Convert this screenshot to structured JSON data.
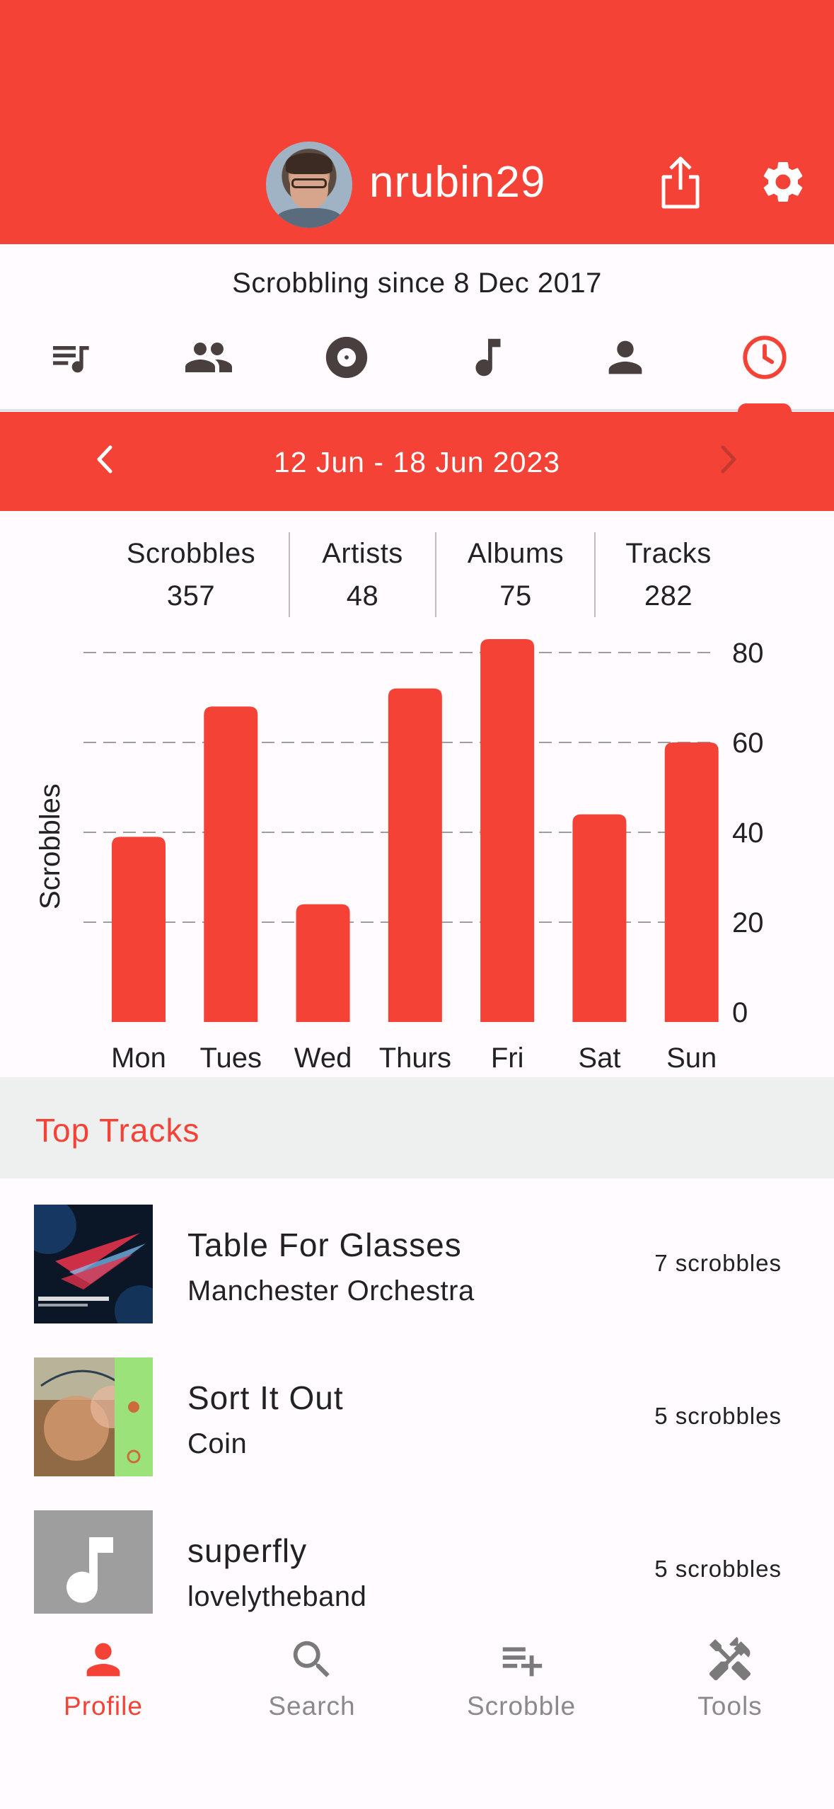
{
  "colors": {
    "accent": "#F44336",
    "icon_dark": "#4a3f3f",
    "inactive": "#8a8a8a"
  },
  "header": {
    "username": "nrubin29",
    "avatar_icon": "user-avatar",
    "share_icon": "share-icon",
    "settings_icon": "gear-icon"
  },
  "profile": {
    "since": "Scrobbling since 8 Dec 2017"
  },
  "tabs": [
    {
      "icon": "queue-music-icon"
    },
    {
      "icon": "people-icon"
    },
    {
      "icon": "album-icon"
    },
    {
      "icon": "music-note-icon"
    },
    {
      "icon": "person-icon"
    },
    {
      "icon": "clock-icon",
      "selected": true
    }
  ],
  "range": {
    "label": "12 Jun - 18 Jun 2023"
  },
  "stats": [
    {
      "label": "Scrobbles",
      "value": "357"
    },
    {
      "label": "Artists",
      "value": "48"
    },
    {
      "label": "Albums",
      "value": "75"
    },
    {
      "label": "Tracks",
      "value": "282"
    }
  ],
  "chart_data": {
    "type": "bar",
    "categories": [
      "Mon",
      "Tues",
      "Wed",
      "Thurs",
      "Fri",
      "Sat",
      "Sun"
    ],
    "values": [
      39,
      68,
      24,
      72,
      83,
      44,
      60
    ],
    "ylabel": "Scrobbles",
    "ylim": [
      0,
      80
    ],
    "yticks": [
      0,
      20,
      40,
      60,
      80
    ],
    "grid": true,
    "bar_color": "#F44336"
  },
  "top_tracks": {
    "title": "Top Tracks",
    "items": [
      {
        "title": "Table For Glasses",
        "artist": "Manchester Orchestra",
        "count": "7 scrobbles"
      },
      {
        "title": "Sort It Out",
        "artist": "Coin",
        "count": "5 scrobbles"
      },
      {
        "title": "superfly",
        "artist": "lovelytheband",
        "count": "5 scrobbles"
      }
    ]
  },
  "bottom_nav": [
    {
      "label": "Profile",
      "icon": "person-icon",
      "active": true
    },
    {
      "label": "Search",
      "icon": "search-icon"
    },
    {
      "label": "Scrobble",
      "icon": "playlist-add-icon"
    },
    {
      "label": "Tools",
      "icon": "tools-icon"
    }
  ]
}
